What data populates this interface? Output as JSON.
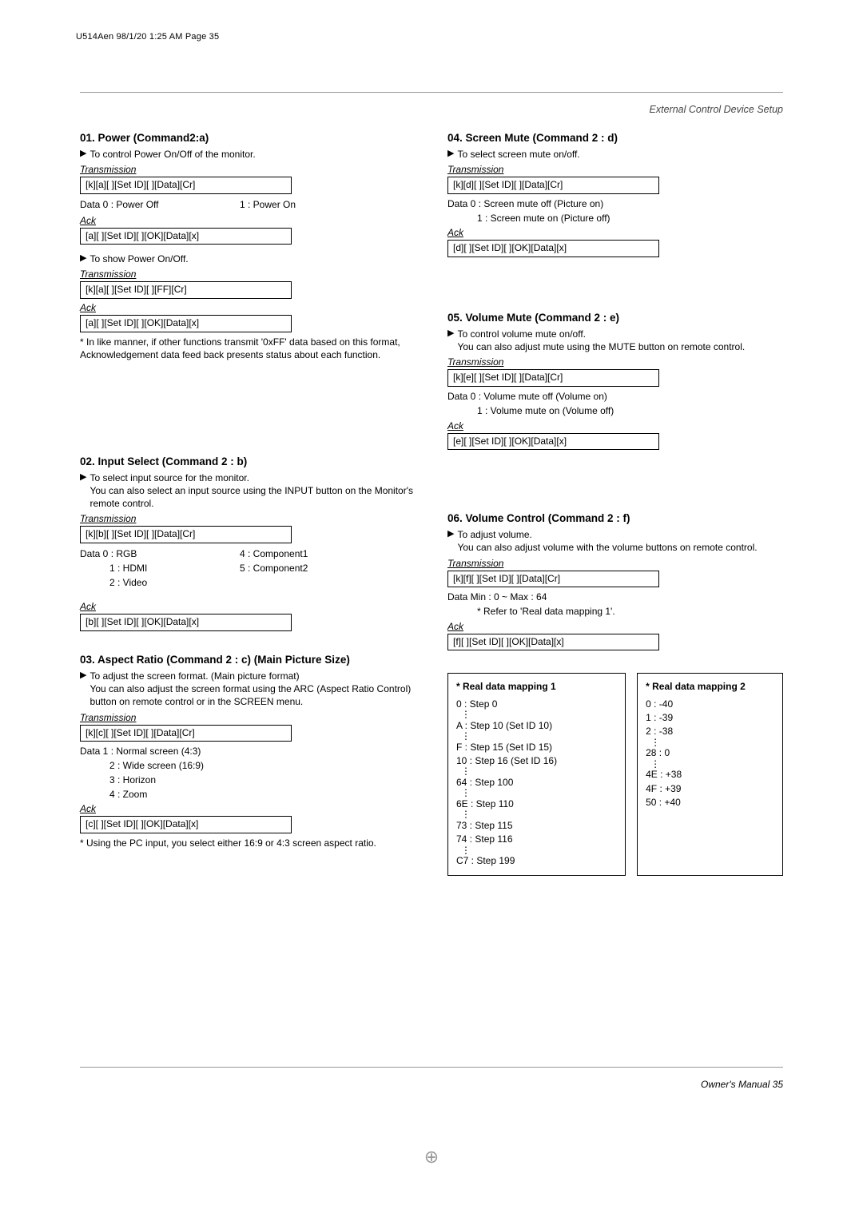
{
  "header": "U514Aen  98/1/20 1:25 AM  Page 35",
  "sectionHeader": "External Control Device Setup",
  "footer": "Owner's Manual   35",
  "regmark": "⊕",
  "left": {
    "c01": {
      "title": "01. Power (Command2:a)",
      "desc1": "To control Power On/Off of the monitor.",
      "t_label": "Transmission",
      "t_code": "[k][a][  ][Set ID][  ][Data][Cr]",
      "data_left": "Data  0  : Power Off",
      "data_right": "1  : Power On",
      "ack_label": "Ack",
      "ack_code": "[a][  ][Set ID][  ][OK][Data][x]",
      "desc2": "To show Power On/Off.",
      "t2_label": "Transmission",
      "t2_code": "[k][a][  ][Set ID][  ][FF][Cr]",
      "ack2_label": "Ack",
      "ack2_code": "[a][  ][Set ID][  ][OK][Data][x]",
      "note": "* In like manner, if other functions transmit '0xFF' data based on this format, Acknowledgement data feed back presents status about each function."
    },
    "c02": {
      "title": "02. Input Select (Command 2 : b)",
      "desc": "To select input source for the monitor.\nYou can also select an input source using the INPUT button on the Monitor's remote control.",
      "t_label": "Transmission",
      "t_code": "[k][b][  ][Set ID][  ][Data][Cr]",
      "data_l0": "Data  0  : RGB",
      "data_l1": "1  : HDMI",
      "data_l2": "2  : Video",
      "data_r0": "4  : Component1",
      "data_r1": "5  : Component2",
      "ack_label": "Ack",
      "ack_code": "[b][  ][Set ID][  ][OK][Data][x]"
    },
    "c03": {
      "title": "03. Aspect Ratio (Command 2 : c) (Main Picture Size)",
      "desc": "To adjust the screen format. (Main picture format)\nYou can also adjust the screen format using the ARC (Aspect Ratio Control) button on remote control or in the SCREEN menu.",
      "t_label": "Transmission",
      "t_code": "[k][c][  ][Set ID][  ][Data][Cr]",
      "d1": "Data  1  :  Normal screen (4:3)",
      "d2": "2  :  Wide screen (16:9)",
      "d3": "3  :  Horizon",
      "d4": "4  :  Zoom",
      "ack_label": "Ack",
      "ack_code": "[c][  ][Set ID][  ][OK][Data][x]",
      "note": "* Using the PC input, you select either 16:9 or 4:3 screen aspect ratio."
    }
  },
  "right": {
    "c04": {
      "title": "04. Screen Mute (Command 2 : d)",
      "desc": "To select screen mute on/off.",
      "t_label": "Transmission",
      "t_code": "[k][d][  ][Set ID][  ][Data][Cr]",
      "d0": "Data  0  :  Screen mute off (Picture on)",
      "d1": "1  :  Screen mute on (Picture off)",
      "ack_label": "Ack",
      "ack_code": "[d][  ][Set ID][  ][OK][Data][x]"
    },
    "c05": {
      "title": "05. Volume Mute (Command 2 : e)",
      "desc": "To control volume mute on/off.\nYou can also adjust mute using the MUTE button on remote control.",
      "t_label": "Transmission",
      "t_code": "[k][e][  ][Set ID][  ][Data][Cr]",
      "d0": "Data  0  :  Volume mute off (Volume on)",
      "d1": "1  :  Volume mute on (Volume off)",
      "ack_label": "Ack",
      "ack_code": "[e][  ][Set ID][  ][OK][Data][x]"
    },
    "c06": {
      "title": "06. Volume Control (Command 2 : f)",
      "desc": "To adjust volume.\nYou can also adjust volume with the volume buttons on remote control.",
      "t_label": "Transmission",
      "t_code": "[k][f][  ][Set ID][  ][Data][Cr]",
      "d0": "Data   Min : 0 ~ Max : 64",
      "d1": "* Refer to 'Real data mapping 1'.",
      "ack_label": "Ack",
      "ack_code": "[f][  ][Set ID][  ][OK][Data][x]"
    },
    "map1": {
      "title": "*  Real data mapping 1",
      "r0": "0   : Step 0",
      "r1": "A  : Step 10 (Set ID 10)",
      "r2": "F   : Step 15 (Set ID 15)",
      "r3": "10 : Step 16 (Set ID 16)",
      "r4": "64 : Step 100",
      "r5": "6E : Step 110",
      "r6": "73 : Step 115",
      "r7": "74 : Step 116",
      "r8": "C7 : Step 199"
    },
    "map2": {
      "title": "*  Real data mapping 2",
      "r0": "0   :  -40",
      "r1": "1   :  -39",
      "r2": "2   :  -38",
      "r3": "28 : 0",
      "r4": "4E : +38",
      "r5": "4F : +39",
      "r6": "50 : +40"
    }
  }
}
